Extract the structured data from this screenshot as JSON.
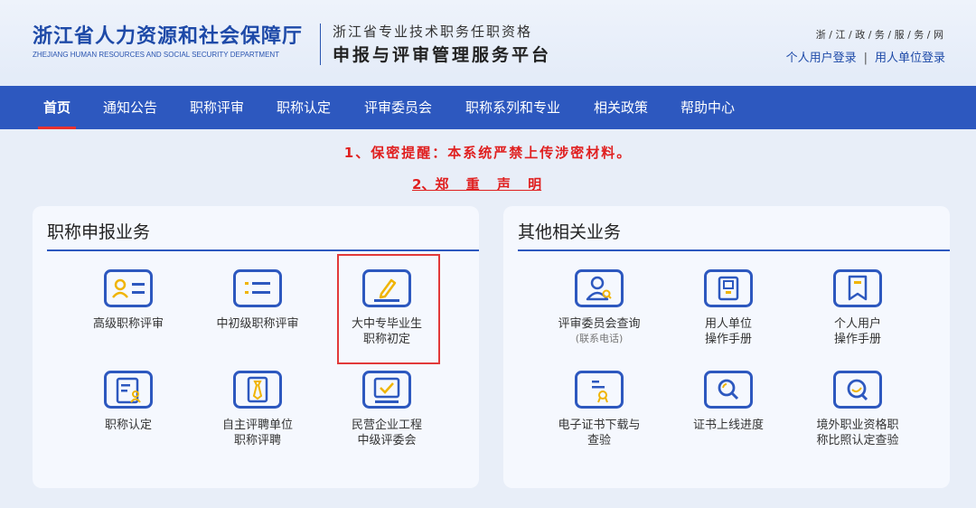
{
  "header": {
    "org_cn": "浙江省人力资源和社会保障厅",
    "org_en": "ZHEJIANG HUMAN RESOURCES AND SOCIAL SECURITY DEPARTMENT",
    "platform_line1": "浙江省专业技术职务任职资格",
    "platform_line2": "申报与评审管理服务平台",
    "site_tag": "浙 / 江 / 政 / 务 / 服 / 务 / 网",
    "login_personal": "个人用户登录",
    "login_separator": "|",
    "login_unit": "用人单位登录"
  },
  "nav": {
    "items": [
      "首页",
      "通知公告",
      "职称评审",
      "职称认定",
      "评审委员会",
      "职称系列和专业",
      "相关政策",
      "帮助中心"
    ]
  },
  "notices": {
    "line1": "1、保密提醒：本系统严禁上传涉密材料。",
    "line2": "2、郑 重 声 明"
  },
  "left_panel": {
    "title": "职称申报业务",
    "tiles": [
      {
        "label": "高级职称评审",
        "icon": "id-card-icon"
      },
      {
        "label": "中初级职称评审",
        "icon": "list-icon"
      },
      {
        "label1": "大中专毕业生",
        "label2": "职称初定",
        "icon": "edit-pen-icon"
      },
      {
        "label": "职称认定",
        "icon": "document-user-icon"
      },
      {
        "label1": "自主评聘单位",
        "label2": "职称评聘",
        "icon": "certificate-tie-icon"
      },
      {
        "label1": "民营企业工程",
        "label2": "中级评委会",
        "icon": "check-box-icon"
      }
    ]
  },
  "right_panel": {
    "title": "其他相关业务",
    "tiles": [
      {
        "label": "评审委员会查询",
        "sublabel": "(联系电话)",
        "icon": "user-search-icon"
      },
      {
        "label1": "用人单位",
        "label2": "操作手册",
        "icon": "manual-book-icon"
      },
      {
        "label1": "个人用户",
        "label2": "操作手册",
        "icon": "bookmark-icon"
      },
      {
        "label1": "电子证书下载与",
        "label2": "查验",
        "icon": "certificate-download-icon"
      },
      {
        "label": "证书上线进度",
        "icon": "magnifier-icon"
      },
      {
        "label1": "境外职业资格职",
        "label2": "称比照认定查验",
        "icon": "search-verify-icon"
      }
    ]
  },
  "colors": {
    "primary": "#2d58bf",
    "icon_blue": "#2d58bf",
    "icon_accent": "#f0b400",
    "notice_red": "#e02020"
  }
}
